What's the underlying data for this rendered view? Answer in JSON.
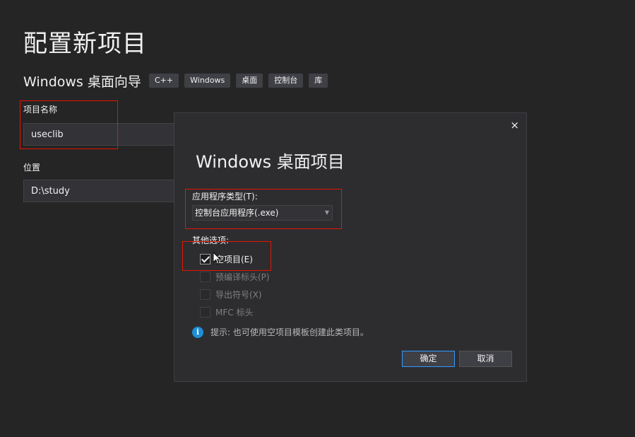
{
  "header": {
    "title": "配置新项目",
    "template_name": "Windows 桌面向导",
    "tags": [
      "C++",
      "Windows",
      "桌面",
      "控制台",
      "库"
    ]
  },
  "form": {
    "project_name_label": "项目名称",
    "project_name_value": "useclib",
    "location_label": "位置",
    "location_value": "D:\\study"
  },
  "dialog": {
    "close_icon": "×",
    "title": "Windows 桌面项目",
    "app_type_label": "应用程序类型(T):",
    "app_type_value": "控制台应用程序(.exe)",
    "other_options_label": "其他选项:",
    "options": [
      {
        "label": "空项目(E)",
        "checked": true,
        "enabled": true
      },
      {
        "label": "预编译标头(P)",
        "checked": false,
        "enabled": false
      },
      {
        "label": "导出符号(X)",
        "checked": false,
        "enabled": false
      },
      {
        "label": "MFC 标头",
        "checked": false,
        "enabled": false
      }
    ],
    "hint": "提示: 也可使用空项目模板创建此类项目。",
    "ok_label": "确定",
    "cancel_label": "取消"
  },
  "colors": {
    "background": "#252526",
    "dialog_background": "#2d2d30",
    "highlight_red": "#e51400",
    "accent_blue": "#3399ff",
    "info_blue": "#1e8fd8"
  },
  "icons": {
    "info": "info-icon",
    "close": "close-icon",
    "dropdown": "chevron-down-icon"
  }
}
